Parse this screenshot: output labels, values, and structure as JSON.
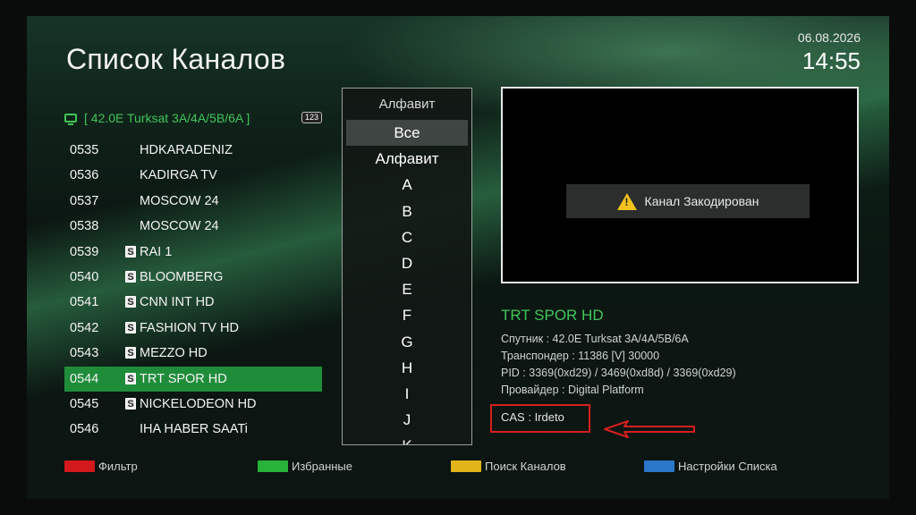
{
  "header": {
    "title": "Список Каналов",
    "date": "06.08.2026",
    "time": "14:55"
  },
  "satellite": {
    "name": "[ 42.0E Turksat 3A/4A/5B/6A ]",
    "badge": "123"
  },
  "channels": [
    {
      "num": "0535",
      "name": "HDKARADENIZ",
      "scrambled": false,
      "selected": false
    },
    {
      "num": "0536",
      "name": "KADIRGA TV",
      "scrambled": false,
      "selected": false
    },
    {
      "num": "0537",
      "name": "MOSCOW 24",
      "scrambled": false,
      "selected": false
    },
    {
      "num": "0538",
      "name": "MOSCOW 24",
      "scrambled": false,
      "selected": false
    },
    {
      "num": "0539",
      "name": "RAI 1",
      "scrambled": true,
      "selected": false
    },
    {
      "num": "0540",
      "name": "BLOOMBERG",
      "scrambled": true,
      "selected": false
    },
    {
      "num": "0541",
      "name": "CNN INT HD",
      "scrambled": true,
      "selected": false
    },
    {
      "num": "0542",
      "name": "FASHION TV HD",
      "scrambled": true,
      "selected": false
    },
    {
      "num": "0543",
      "name": "MEZZO HD",
      "scrambled": true,
      "selected": false
    },
    {
      "num": "0544",
      "name": "TRT SPOR HD",
      "scrambled": true,
      "selected": true
    },
    {
      "num": "0545",
      "name": "NICKELODEON HD",
      "scrambled": true,
      "selected": false
    },
    {
      "num": "0546",
      "name": "IHA HABER SAATi",
      "scrambled": false,
      "selected": false
    }
  ],
  "scramble_icon_glyph": "S",
  "sort_menu": {
    "title": "Алфавит",
    "items": [
      "Все",
      "Алфавит",
      "A",
      "B",
      "C",
      "D",
      "E",
      "F",
      "G",
      "H",
      "I",
      "J",
      "K"
    ],
    "highlighted_index": 0
  },
  "preview": {
    "message": "Канал Закодирован"
  },
  "channel_info": {
    "name": "TRT SPOR HD",
    "lines": [
      "Спутник : 42.0E Turksat 3A/4A/5B/6A",
      "Транспондер : 11386 [V] 30000",
      "PID : 3369(0xd29) / 3469(0xd8d) / 3369(0xd29)",
      "Провайдер : Digital Platform"
    ],
    "cas": "CAS : Irdeto"
  },
  "footer": [
    {
      "label": "Фильтр",
      "color": "#d3191c"
    },
    {
      "label": "Избранные",
      "color": "#27b23a"
    },
    {
      "label": "Поиск Каналов",
      "color": "#e3b419"
    },
    {
      "label": "Настройки Списка",
      "color": "#2a77c9"
    }
  ],
  "colors": {
    "accent_green": "#3fc55a",
    "selection": "#1f8c3a",
    "annotation_red": "#d71f1f"
  }
}
